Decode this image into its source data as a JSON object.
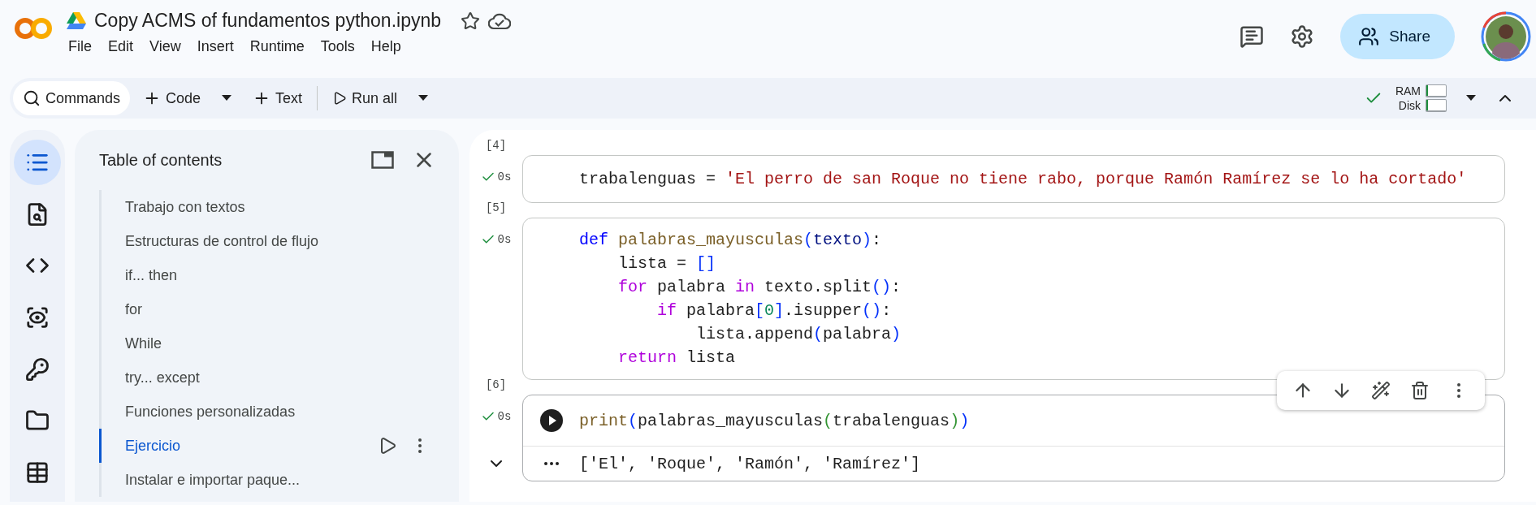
{
  "menu": [
    "File",
    "Edit",
    "View",
    "Insert",
    "Runtime",
    "Tools",
    "Help"
  ],
  "document": {
    "title": "Copy ACMS of fundamentos python.ipynb"
  },
  "header": {
    "share": "Share"
  },
  "toolbar": {
    "commands": "Commands",
    "add_code": "Code",
    "add_text": "Text",
    "run_all": "Run all",
    "runtime": {
      "connected": true,
      "ram": {
        "label": "RAM",
        "level": 0.1
      },
      "disk": {
        "label": "Disk",
        "level": 0.1
      }
    }
  },
  "rail": [
    {
      "kind": "toc",
      "selected": true
    },
    {
      "kind": "find",
      "selected": false
    },
    {
      "kind": "snippets",
      "selected": false
    },
    {
      "kind": "variables",
      "selected": false
    },
    {
      "kind": "secrets",
      "selected": false
    },
    {
      "kind": "files",
      "selected": false
    },
    {
      "kind": "data",
      "selected": false
    }
  ],
  "toc": {
    "title": "Table of contents",
    "items": [
      {
        "label": "Trabajo con textos",
        "selected": false
      },
      {
        "label": "Estructuras de control de flujo",
        "selected": false
      },
      {
        "label": "if... then",
        "selected": false
      },
      {
        "label": "for",
        "selected": false
      },
      {
        "label": "While",
        "selected": false
      },
      {
        "label": "try... except",
        "selected": false
      },
      {
        "label": "Funciones personalizadas",
        "selected": false
      },
      {
        "label": "Ejercicio",
        "selected": true
      },
      {
        "label": "Instalar e importar paque...",
        "selected": false
      }
    ]
  },
  "cells": [
    {
      "exec_count": "[4]",
      "time": "0s",
      "succeeded": true,
      "focused": false,
      "code": [
        [
          {
            "kind": "plain",
            "text": "trabalenguas = "
          },
          {
            "kind": "str",
            "text": "'El perro de san Roque no tiene rabo, porque Ramón Ramírez se lo ha cortado'"
          }
        ]
      ]
    },
    {
      "exec_count": "[5]",
      "time": "0s",
      "succeeded": true,
      "focused": false,
      "code": [
        [
          {
            "kind": "kw",
            "text": "def"
          },
          {
            "kind": "fn",
            "text": " palabras_mayusculas"
          },
          {
            "kind": "br",
            "text": "("
          },
          {
            "kind": "var",
            "text": "texto"
          },
          {
            "kind": "br",
            "text": ")"
          },
          {
            "kind": "plain",
            "text": ":"
          }
        ],
        [
          {
            "kind": "plain",
            "text": "    lista = "
          },
          {
            "kind": "br",
            "text": "[]"
          }
        ],
        [
          {
            "kind": "ctrl",
            "text": "    for"
          },
          {
            "kind": "plain",
            "text": " palabra "
          },
          {
            "kind": "ctrl",
            "text": "in"
          },
          {
            "kind": "plain",
            "text": " texto.split"
          },
          {
            "kind": "br",
            "text": "()"
          },
          {
            "kind": "plain",
            "text": ":"
          }
        ],
        [
          {
            "kind": "ctrl",
            "text": "        if"
          },
          {
            "kind": "plain",
            "text": " palabra"
          },
          {
            "kind": "br",
            "text": "["
          },
          {
            "kind": "num",
            "text": "0"
          },
          {
            "kind": "br",
            "text": "]"
          },
          {
            "kind": "plain",
            "text": ".isupper"
          },
          {
            "kind": "br",
            "text": "()"
          },
          {
            "kind": "plain",
            "text": ":"
          }
        ],
        [
          {
            "kind": "plain",
            "text": "            lista.append"
          },
          {
            "kind": "br",
            "text": "("
          },
          {
            "kind": "plain",
            "text": "palabra"
          },
          {
            "kind": "br",
            "text": ")"
          }
        ],
        [
          {
            "kind": "ctrl",
            "text": "    return"
          },
          {
            "kind": "plain",
            "text": " lista"
          }
        ]
      ]
    },
    {
      "exec_count": "[6]",
      "time": "0s",
      "succeeded": true,
      "focused": true,
      "code": [
        [
          {
            "kind": "fn",
            "text": "print"
          },
          {
            "kind": "br",
            "text": "("
          },
          {
            "kind": "plain",
            "text": "palabras_mayusculas"
          },
          {
            "kind": "br2",
            "text": "("
          },
          {
            "kind": "plain",
            "text": "trabalenguas"
          },
          {
            "kind": "br2",
            "text": ")"
          },
          {
            "kind": "br",
            "text": ")"
          }
        ]
      ],
      "output": "['El', 'Roque', 'Ramón', 'Ramírez']"
    }
  ]
}
